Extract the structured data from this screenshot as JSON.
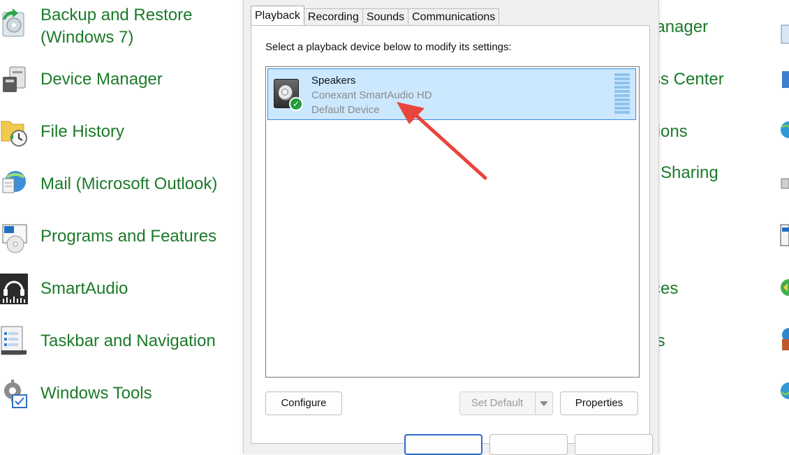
{
  "control_panel": {
    "left_items": [
      {
        "label_line1": "Backup and Restore",
        "label_line2": "(Windows 7)",
        "icon": "backup-restore-icon"
      },
      {
        "label": "Device Manager",
        "icon": "device-manager-icon"
      },
      {
        "label": "File History",
        "icon": "file-history-icon"
      },
      {
        "label": "Mail (Microsoft Outlook)",
        "icon": "mail-icon"
      },
      {
        "label": "Programs and Features",
        "icon": "programs-features-icon"
      },
      {
        "label": "SmartAudio",
        "icon": "smartaudio-icon"
      },
      {
        "label": "Taskbar and Navigation",
        "icon": "taskbar-icon"
      },
      {
        "label": "Windows Tools",
        "icon": "windows-tools-icon"
      }
    ],
    "right_items": [
      {
        "label": "lanager"
      },
      {
        "label": "ss Center"
      },
      {
        "label": "tions"
      },
      {
        "label": "l Sharing"
      },
      {
        "label": "ces"
      },
      {
        "label": "ts"
      }
    ],
    "link_color": "#1b7a2a"
  },
  "dialog": {
    "tabs": [
      "Playback",
      "Recording",
      "Sounds",
      "Communications"
    ],
    "active_tab": "Playback",
    "instruction": "Select a playback device below to modify its settings:",
    "device": {
      "name": "Speakers",
      "driver": "Conexant SmartAudio HD",
      "status": "Default Device",
      "icon": "speaker-icon",
      "badge": "default-check-icon"
    },
    "buttons": {
      "configure": "Configure",
      "set_default": "Set Default",
      "properties": "Properties"
    },
    "selection_color": "#cce8ff"
  },
  "annotation": {
    "arrow_color": "#e8453c"
  }
}
